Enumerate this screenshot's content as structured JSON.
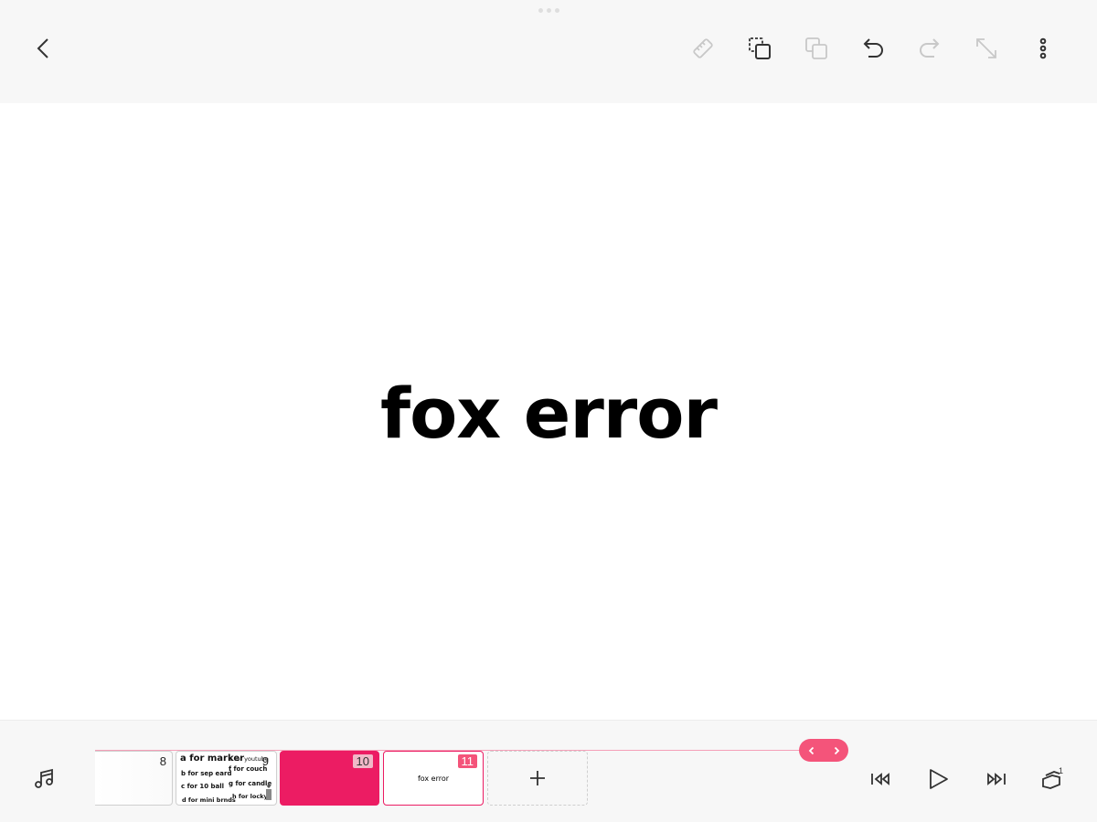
{
  "toolbar": {
    "back": "chevron-left-icon",
    "tools": [
      "ruler-icon",
      "copy-frame-icon",
      "paste-frame-icon",
      "undo-icon",
      "redo-icon",
      "resize-icon",
      "more-vertical-icon"
    ]
  },
  "canvas": {
    "text": "fox error"
  },
  "timeline": {
    "frames": [
      {
        "number": "8"
      },
      {
        "number": "9",
        "texts": [
          "a for marker",
          "e for youtube",
          "b for sep eard",
          "f for couch",
          "c for 10 ball",
          "g for candle",
          "d for mini brnds",
          "h for locky"
        ]
      },
      {
        "number": "10",
        "color": "#ec1c63"
      },
      {
        "number": "11",
        "text": "fox error"
      }
    ],
    "add_label": "+",
    "nav_prev": "‹",
    "nav_next": "›"
  },
  "bottom": {
    "layer_count": "1"
  },
  "colors": {
    "accent": "#ec1c63",
    "accent_light": "#f4547a",
    "bar_bg": "#f7f7f7"
  }
}
